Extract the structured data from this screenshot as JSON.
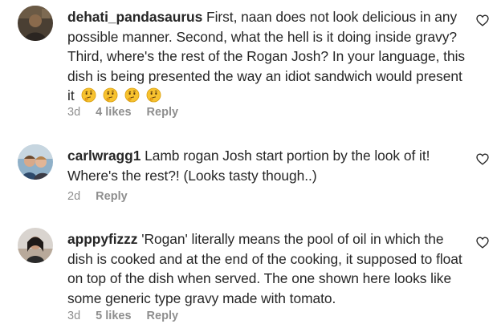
{
  "comments": [
    {
      "username": "dehati_pandasaurus",
      "text": "First, naan does not look delicious in any possible manner. Second, what the hell is it doing inside gravy? Third, where's the rest of the Rogan Josh? In your language, this dish is being presented the way an idiot sandwich would present it",
      "emoji_icon": "thinking-face-icon",
      "emoji_count": 4,
      "time": "3d",
      "likes": "4 likes",
      "reply": "Reply"
    },
    {
      "username": "carlwragg1",
      "text": "Lamb rogan Josh start portion by the look of it! Where's the rest?! (Looks tasty though..)",
      "time": "2d",
      "reply": "Reply"
    },
    {
      "username": "apppyfizzz",
      "text": "'Rogan' literally means the pool of oil in which the dish is cooked and at the end of the cooking, it supposed to float on top of the dish when served. The one shown here looks like some generic type gravy made with tomato.",
      "time": "3d",
      "likes": "5 likes",
      "reply": "Reply"
    }
  ],
  "icons": {
    "like": "heart-outline-icon"
  },
  "colors": {
    "text": "#262626",
    "secondary": "#8e8e8e",
    "background": "#ffffff"
  }
}
